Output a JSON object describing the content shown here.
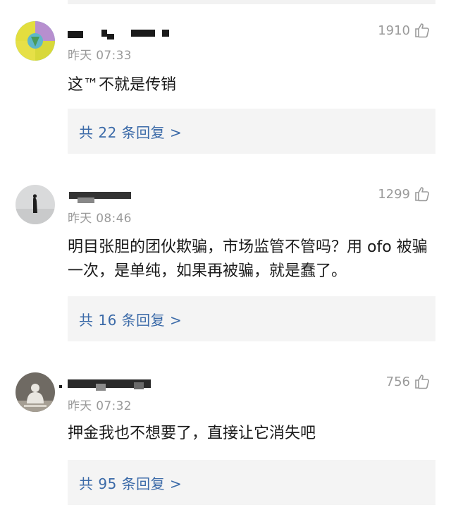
{
  "comments": [
    {
      "time": "昨天 07:33",
      "likes": "1910",
      "text": "这™不就是传销",
      "replies": "共 22 条回复 >"
    },
    {
      "time": "昨天 08:46",
      "likes": "1299",
      "text": "明目张胆的团伙欺骗，市场监管不管吗？用 ofo 被骗一次，是单纯，如果再被骗，就是蠢了。",
      "replies": "共 16 条回复 >"
    },
    {
      "time": "昨天 07:32",
      "likes": "756",
      "text": "押金我也不想要了，直接让它消失吧",
      "replies": "共 95 条回复 >"
    }
  ],
  "colors": {
    "reply_link": "#3b6aa8",
    "meta_gray": "#9a9a9a",
    "reply_bg": "#f4f4f4"
  },
  "icons": {
    "like": "thumbs-up-outline-icon"
  }
}
